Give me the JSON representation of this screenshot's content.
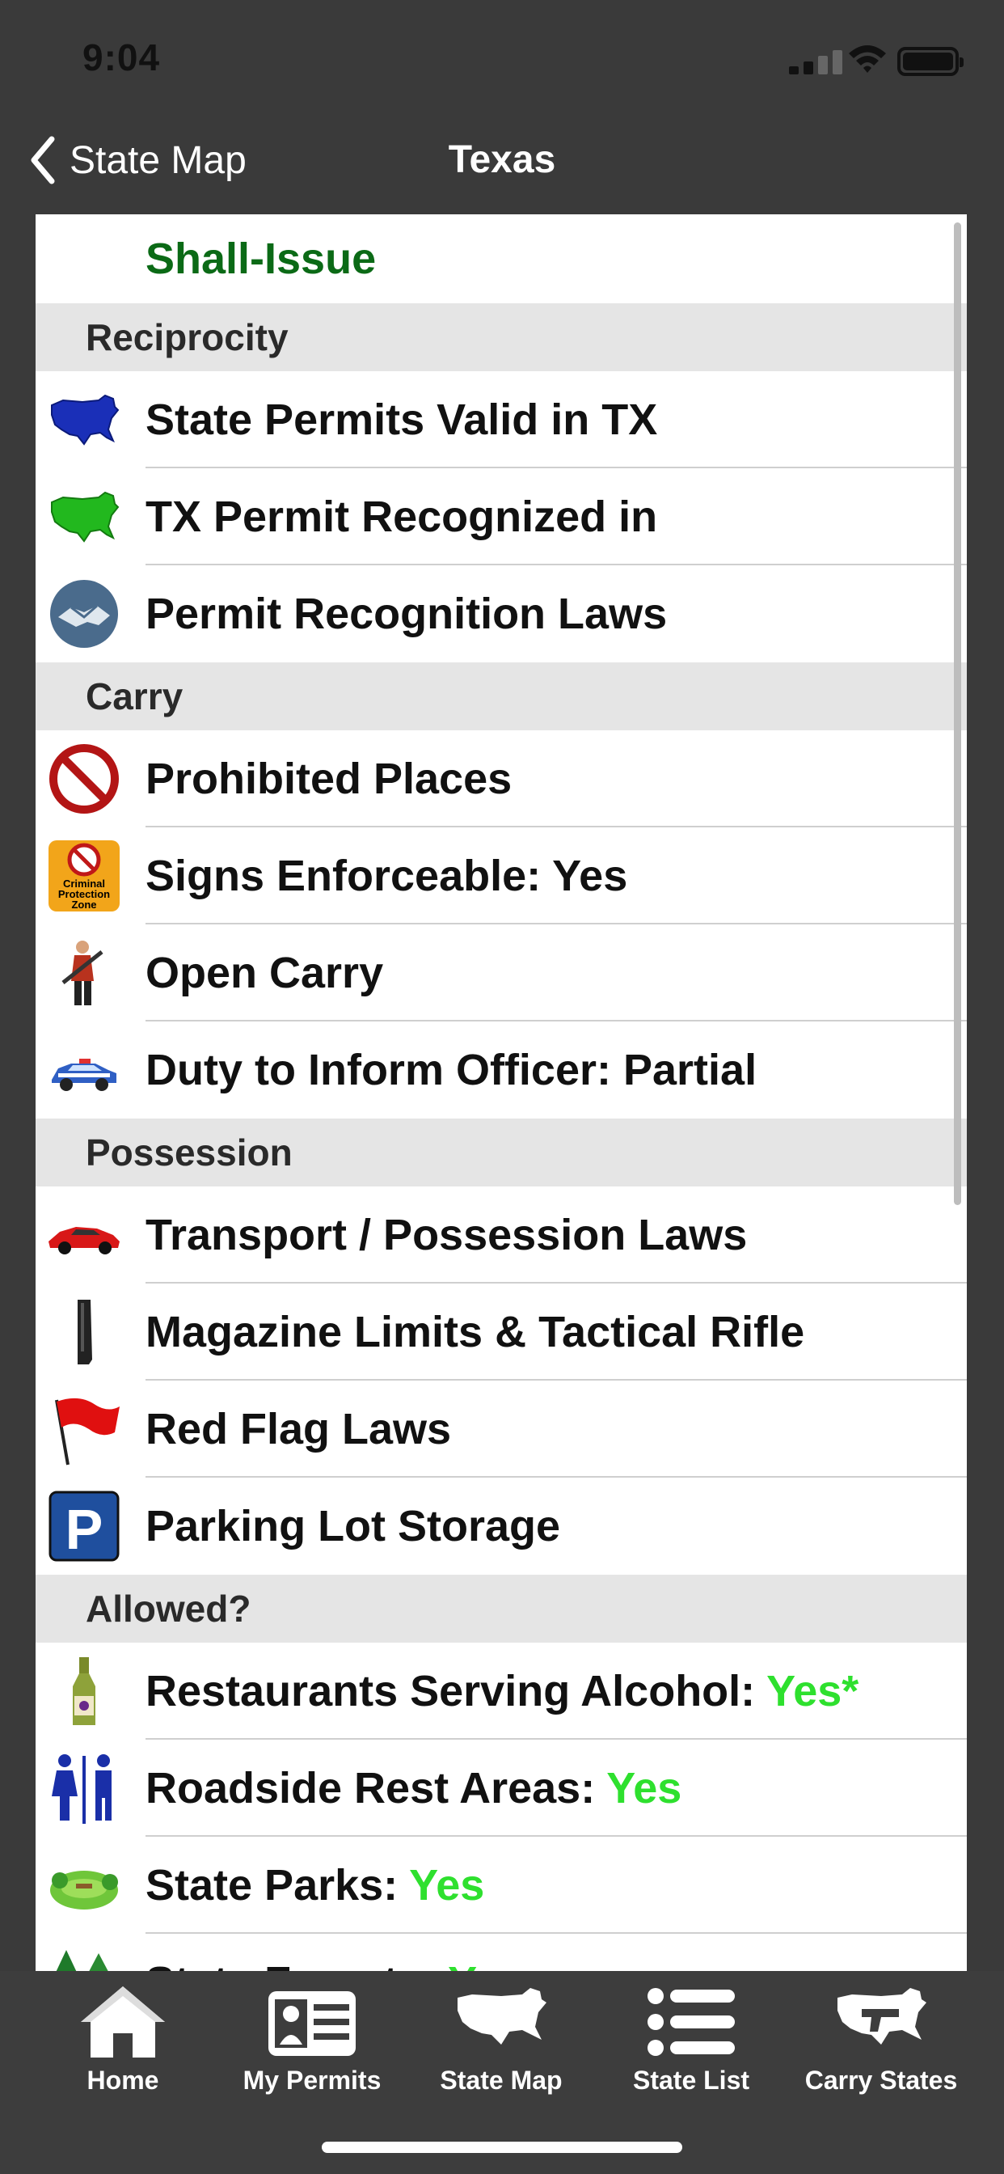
{
  "status": {
    "time": "9:04"
  },
  "nav": {
    "back_label": "State Map",
    "title": "Texas"
  },
  "classification": "Shall-Issue",
  "sections": [
    {
      "header": "Reciprocity",
      "items": [
        {
          "label": "State Permits Valid in TX",
          "icon": "blue-usa-map-icon"
        },
        {
          "label": "TX Permit Recognized in",
          "icon": "green-usa-map-icon"
        },
        {
          "label": "Permit Recognition Laws",
          "icon": "handshake-icon"
        }
      ]
    },
    {
      "header": "Carry",
      "items": [
        {
          "label": "Prohibited Places",
          "icon": "prohibited-sign-icon"
        },
        {
          "label": "Signs Enforceable: Yes",
          "icon": "criminal-protection-zone-sign-icon",
          "icon_text": "Criminal Protection Zone"
        },
        {
          "label": "Open Carry",
          "icon": "person-with-rifle-icon"
        },
        {
          "label": "Duty to Inform Officer: Partial",
          "icon": "police-car-icon"
        }
      ]
    },
    {
      "header": "Possession",
      "items": [
        {
          "label": "Transport / Possession Laws",
          "icon": "red-car-icon"
        },
        {
          "label": "Magazine Limits & Tactical Rifle",
          "icon": "magazine-icon"
        },
        {
          "label": "Red Flag Laws",
          "icon": "red-flag-icon"
        },
        {
          "label": "Parking Lot Storage",
          "icon": "parking-sign-icon"
        }
      ]
    },
    {
      "header": "Allowed?",
      "items": [
        {
          "label": "Restaurants Serving Alcohol:",
          "value": "Yes*",
          "icon": "wine-bottle-icon"
        },
        {
          "label": "Roadside Rest Areas:",
          "value": "Yes",
          "icon": "restroom-icon"
        },
        {
          "label": "State Parks:",
          "value": "Yes",
          "icon": "park-icon"
        },
        {
          "label": "State Forests:",
          "value": "Yes",
          "icon": "pine-trees-icon"
        }
      ]
    }
  ],
  "tabs": [
    {
      "label": "Home",
      "icon": "house-icon"
    },
    {
      "label": "My Permits",
      "icon": "id-card-icon"
    },
    {
      "label": "State Map",
      "icon": "usa-map-icon"
    },
    {
      "label": "State List",
      "icon": "list-icon"
    },
    {
      "label": "Carry States",
      "icon": "usa-map-gun-icon"
    }
  ],
  "colors": {
    "classification": "#0b6a16",
    "yes_value": "#2ee02e",
    "section_bg": "#e5e5e5",
    "bar_bg": "#3a3a3a"
  }
}
